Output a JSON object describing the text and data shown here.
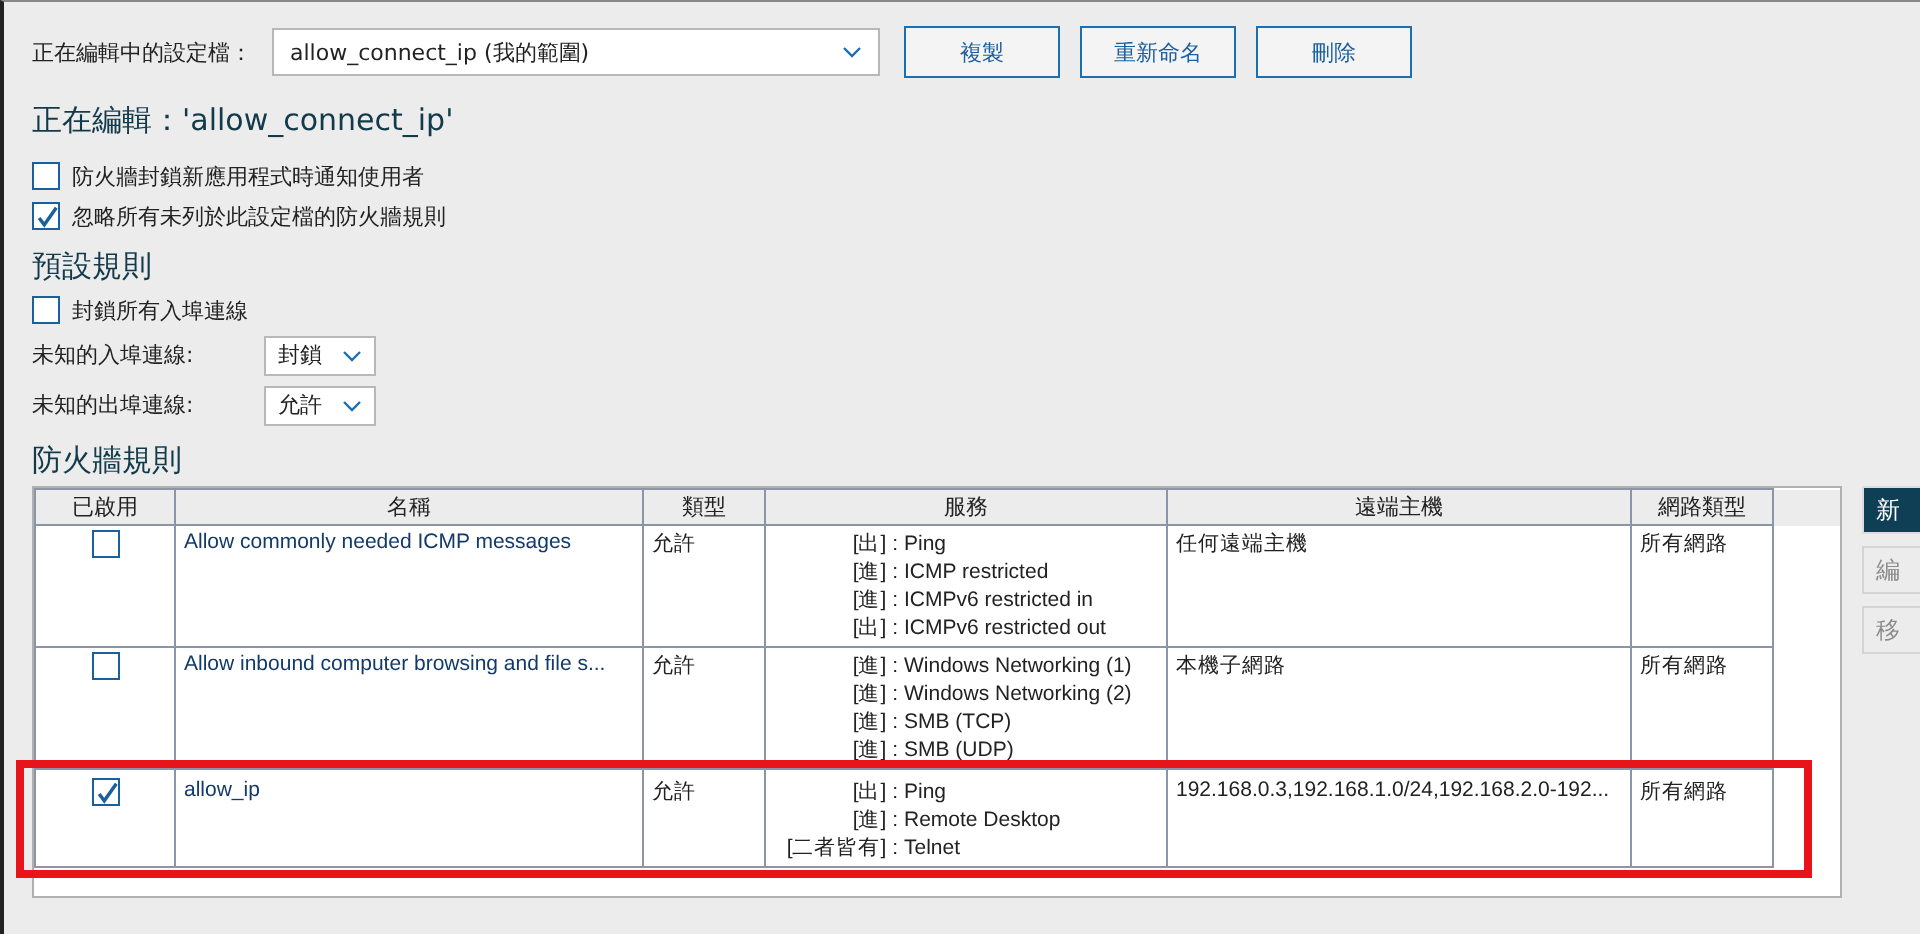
{
  "profile_bar": {
    "label": "正在編輯中的設定檔：",
    "dropdown_value": "allow_connect_ip (我的範圍)",
    "buttons": [
      "複製",
      "重新命名",
      "刪除"
    ]
  },
  "editing_title": "正在編輯：'allow_connect_ip'",
  "options": [
    {
      "label": "防火牆封鎖新應用程式時通知使用者",
      "checked": false
    },
    {
      "label": "忽略所有未列於此設定檔的防火牆規則",
      "checked": true
    }
  ],
  "default_rules": {
    "heading": "預設規則",
    "block_all": {
      "label": "封鎖所有入埠連線",
      "checked": false
    },
    "selects": [
      {
        "label": "未知的入埠連線:",
        "value": "封鎖"
      },
      {
        "label": "未知的出埠連線:",
        "value": "允許"
      }
    ]
  },
  "firewall_rules": {
    "heading": "防火牆規則",
    "table": {
      "columns": [
        "已啟用",
        "名稱",
        "類型",
        "服務",
        "遠端主機",
        "網路類型"
      ],
      "rows": [
        {
          "enabled": false,
          "name": "Allow commonly needed ICMP messages",
          "type": "允許",
          "services": [
            {
              "prefix": "[出] :",
              "name": "Ping"
            },
            {
              "prefix": "[進] :",
              "name": "ICMP restricted"
            },
            {
              "prefix": "[進] :",
              "name": "ICMPv6 restricted in"
            },
            {
              "prefix": "[出] :",
              "name": "ICMPv6 restricted out"
            }
          ],
          "remote_host": "任何遠端主機",
          "network_type": "所有網路",
          "highlighted": false
        },
        {
          "enabled": false,
          "name": "Allow inbound computer browsing and file s...",
          "type": "允許",
          "services": [
            {
              "prefix": "[進] :",
              "name": "Windows Networking (1)"
            },
            {
              "prefix": "[進] :",
              "name": "Windows Networking (2)"
            },
            {
              "prefix": "[進] :",
              "name": "SMB (TCP)"
            },
            {
              "prefix": "[進] :",
              "name": "SMB (UDP)"
            }
          ],
          "remote_host": "本機子網路",
          "network_type": "所有網路",
          "highlighted": false
        },
        {
          "enabled": true,
          "name": "allow_ip",
          "type": "允許",
          "services": [
            {
              "prefix": "[出] :",
              "name": "Ping"
            },
            {
              "prefix": "[進] :",
              "name": "Remote Desktop"
            },
            {
              "prefix": "[二者皆有] :",
              "name": "Telnet"
            }
          ],
          "remote_host": "192.168.0.3,192.168.1.0/24,192.168.2.0-192...",
          "network_type": "所有網路",
          "highlighted": true
        }
      ]
    },
    "side_buttons": [
      {
        "label": "新",
        "disabled": false
      },
      {
        "label": "編",
        "disabled": true
      },
      {
        "label": "移",
        "disabled": true
      }
    ]
  }
}
